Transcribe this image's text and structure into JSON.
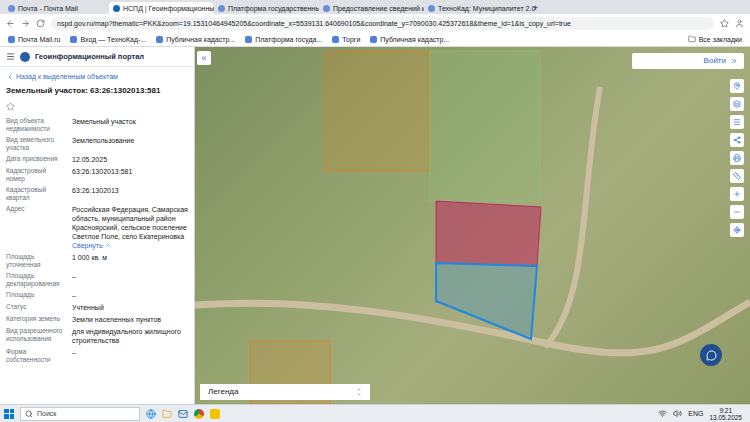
{
  "browser": {
    "tabs": [
      {
        "label": "Почта - Почта Mail",
        "selected": false
      },
      {
        "label": "НСПД | Геоинформационны",
        "selected": true
      },
      {
        "label": "Платформа государственны",
        "selected": false
      },
      {
        "label": "Предоставление сведений и",
        "selected": false
      },
      {
        "label": "ТехноКад: Муниципалитет 2.0",
        "selected": false
      }
    ],
    "new_tab": "+",
    "address": "nspd.gov.ru/map?thematic=PKK&zoom=19.15310464945205&coordinate_x=5539131.640690105&coordinate_y=7090030.425372618&theme_id=1&is_copy_url=true",
    "bookmarks": [
      "Почта Mail.ru",
      "Вход — ТехноКад-...",
      "Публичная кадастр...",
      "Платформа госуда...",
      "Торги",
      "Публичная кадастр..."
    ],
    "all_bookmarks": "Все закладки"
  },
  "sidebar": {
    "portal_title": "Геоинформационный портал",
    "back_link": "Назад к выделенным объектам",
    "object_title": "Земельный участок: 63:26:1302013:581",
    "fields": [
      {
        "label": "Вид объекта недвижимости",
        "value": "Земельный участок"
      },
      {
        "label": "Вид земельного участка",
        "value": "Землепользование"
      },
      {
        "label": "Дата присвоения",
        "value": "12.05.2025"
      },
      {
        "label": "Кадастровый номер",
        "value": "63:26:1302013:581"
      },
      {
        "label": "Кадастровый квартал",
        "value": "63:26:1302013"
      },
      {
        "label": "Адрес",
        "value": "Российская Федерация, Самарская область, муниципальный район Красноярский, сельское поселение Светлое Поле, село Екатериновка",
        "link": "Свернуть"
      },
      {
        "label": "Площадь уточненная",
        "value": "1 000 кв. м"
      },
      {
        "label": "Площадь декларированная",
        "value": "–"
      },
      {
        "label": "Площадь",
        "value": "–"
      },
      {
        "label": "Статус",
        "value": "Учтенный"
      },
      {
        "label": "Категория земель",
        "value": "Земли населенных пунктов"
      },
      {
        "label": "Вид разрешенного использования",
        "value": "для индивидуального жилищного строительства"
      },
      {
        "label": "Форма собственности",
        "value": "–"
      }
    ]
  },
  "map": {
    "collapse": "«",
    "login": "Войти",
    "legend": "Легенда",
    "parcels": [
      {
        "selected": false,
        "color": "#d9822b"
      },
      {
        "selected": false,
        "color": "#8fbf7a"
      },
      {
        "selected": false,
        "color": "#d9822b"
      },
      {
        "selected": false,
        "color": "#c2185b"
      },
      {
        "selected": true,
        "color": "#1e88e5"
      }
    ]
  },
  "taskbar": {
    "search": "Поиск",
    "lang": "ENG",
    "time": "9:21",
    "date": "13.05.2025"
  }
}
